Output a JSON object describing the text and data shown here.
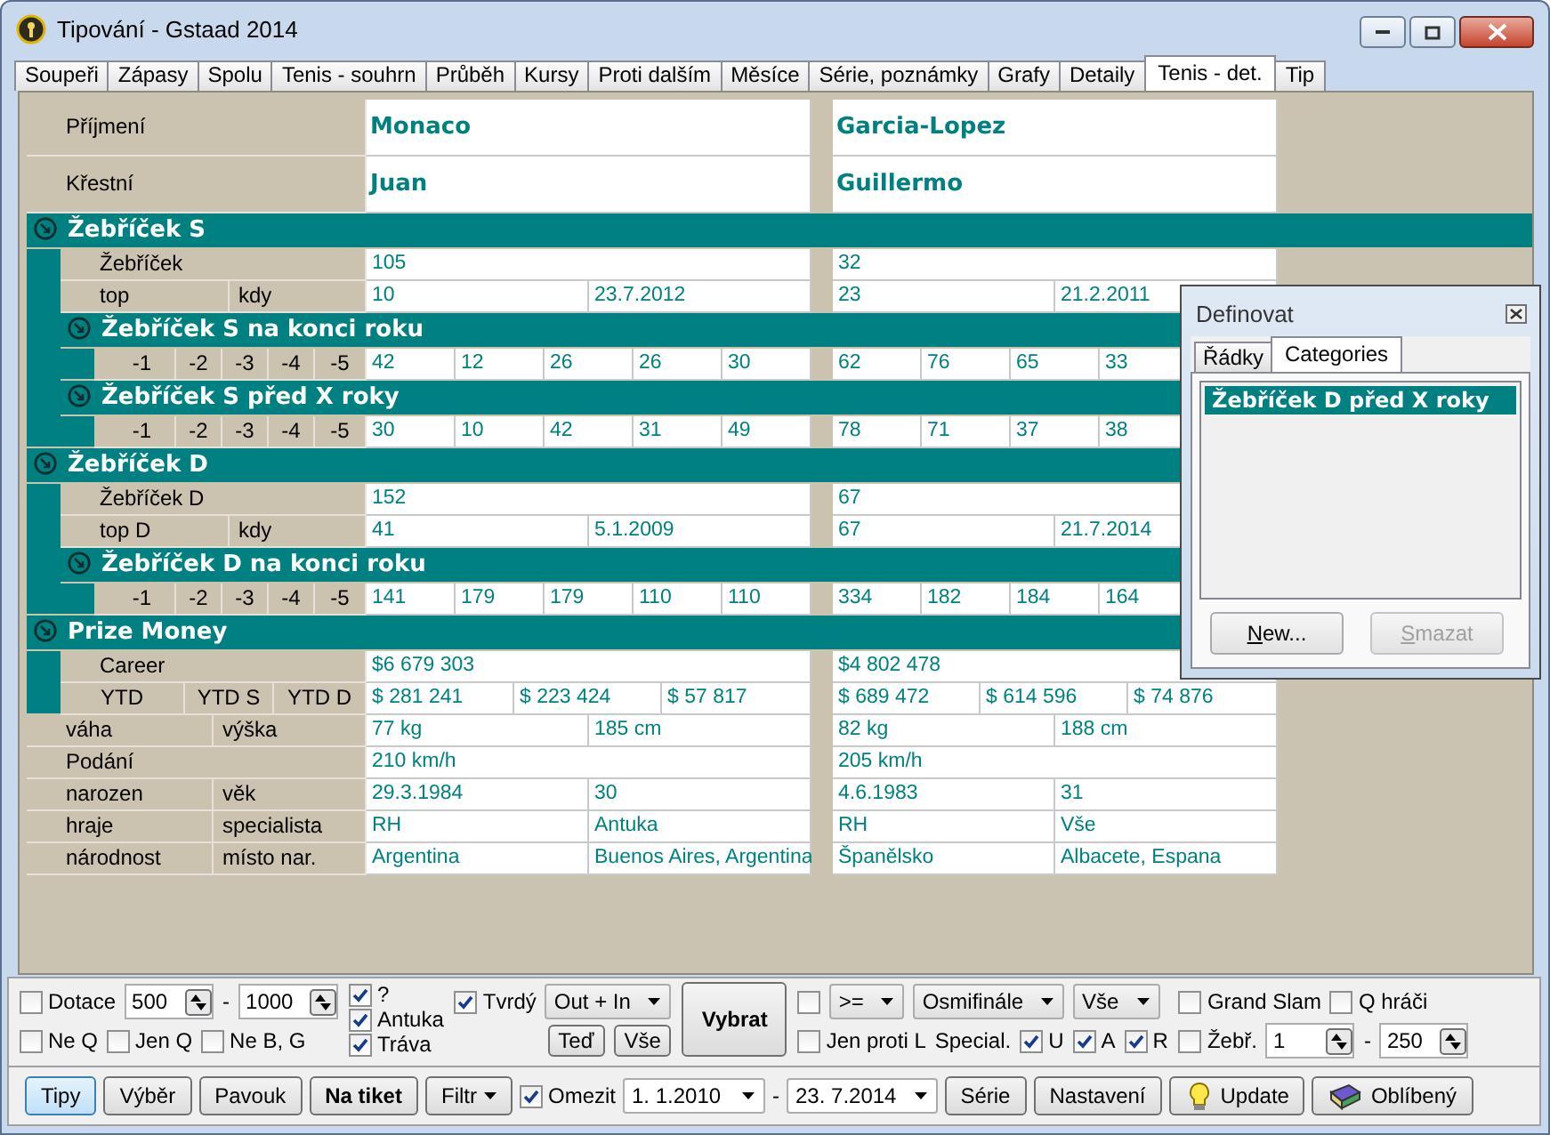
{
  "window": {
    "title": "Tipování - Gstaad 2014"
  },
  "tabs": [
    {
      "label": "Soupeři",
      "selected": false
    },
    {
      "label": "Zápasy",
      "selected": false
    },
    {
      "label": "Spolu",
      "selected": false
    },
    {
      "label": "Tenis - souhrn",
      "selected": false
    },
    {
      "label": "Průběh",
      "selected": false
    },
    {
      "label": "Kursy",
      "selected": false
    },
    {
      "label": "Proti dalším",
      "selected": false
    },
    {
      "label": "Měsíce",
      "selected": false
    },
    {
      "label": "Série, poznámky",
      "selected": false
    },
    {
      "label": "Grafy",
      "selected": false
    },
    {
      "label": "Detaily",
      "selected": false
    },
    {
      "label": "Tenis - det.",
      "selected": true
    },
    {
      "label": "Tip",
      "selected": false
    }
  ],
  "details": [
    {
      "kind": "name",
      "labels": [
        "Příjmení"
      ],
      "cells": [
        [
          "Monaco"
        ],
        [
          "Garcia-Lopez"
        ]
      ]
    },
    {
      "kind": "name",
      "labels": [
        "Křestní"
      ],
      "cells": [
        [
          "Juan"
        ],
        [
          "Guillermo"
        ]
      ]
    },
    {
      "kind": "group",
      "title": "Žebříček S",
      "items": [
        {
          "kind": "row",
          "labels": [
            "Žebříček"
          ],
          "cells": [
            [
              "105"
            ],
            [
              "32"
            ]
          ]
        },
        {
          "kind": "row",
          "labels": [
            "top",
            "kdy"
          ],
          "cells": [
            [
              "10",
              "23.7.2012"
            ],
            [
              "23",
              "21.2.2011"
            ]
          ]
        },
        {
          "kind": "group",
          "title": "Žebříček S na konci roku",
          "items": [
            {
              "kind": "row",
              "labels": [
                "-1",
                "-2",
                "-3",
                "-4",
                "-5"
              ],
              "cells": [
                [
                  "42",
                  "12",
                  "26",
                  "26",
                  "30"
                ],
                [
                  "62",
                  "76",
                  "65",
                  "33"
                ]
              ]
            }
          ]
        },
        {
          "kind": "group",
          "title": "Žebříček S před X roky",
          "items": [
            {
              "kind": "row",
              "labels": [
                "-1",
                "-2",
                "-3",
                "-4",
                "-5"
              ],
              "cells": [
                [
                  "30",
                  "10",
                  "42",
                  "31",
                  "49"
                ],
                [
                  "78",
                  "71",
                  "37",
                  "38"
                ]
              ]
            }
          ]
        }
      ]
    },
    {
      "kind": "group",
      "title": "Žebříček D",
      "items": [
        {
          "kind": "row",
          "labels": [
            "Žebříček D"
          ],
          "cells": [
            [
              "152"
            ],
            [
              "67"
            ]
          ]
        },
        {
          "kind": "row",
          "labels": [
            "top D",
            "kdy"
          ],
          "cells": [
            [
              "41",
              "5.1.2009"
            ],
            [
              "67",
              "21.7.2014"
            ]
          ]
        },
        {
          "kind": "group",
          "title": "Žebříček D na konci roku",
          "items": [
            {
              "kind": "row",
              "labels": [
                "-1",
                "-2",
                "-3",
                "-4",
                "-5"
              ],
              "cells": [
                [
                  "141",
                  "179",
                  "179",
                  "110",
                  "110"
                ],
                [
                  "334",
                  "182",
                  "184",
                  "164"
                ]
              ]
            }
          ]
        }
      ]
    },
    {
      "kind": "group",
      "title": "Prize Money",
      "items": [
        {
          "kind": "row",
          "labels": [
            "Career"
          ],
          "cells": [
            [
              "$6 679 303"
            ],
            [
              "$4 802 478"
            ]
          ]
        },
        {
          "kind": "row",
          "labels": [
            "YTD",
            "YTD S",
            "YTD D"
          ],
          "cells": [
            [
              "$ 281 241",
              "$ 223 424",
              "$ 57 817"
            ],
            [
              "$ 689 472",
              "$ 614 596",
              "$ 74 876"
            ]
          ]
        }
      ]
    },
    {
      "kind": "row",
      "labels": [
        "váha",
        "výška"
      ],
      "cells": [
        [
          "77 kg",
          "185 cm"
        ],
        [
          "82 kg",
          "188 cm"
        ]
      ]
    },
    {
      "kind": "row",
      "labels": [
        "Podání"
      ],
      "cells": [
        [
          "210 km/h"
        ],
        [
          "205 km/h"
        ]
      ]
    },
    {
      "kind": "row",
      "labels": [
        "narozen",
        "věk"
      ],
      "cells": [
        [
          "29.3.1984",
          "30"
        ],
        [
          "4.6.1983",
          "31"
        ]
      ]
    },
    {
      "kind": "row",
      "labels": [
        "hraje",
        "specialista"
      ],
      "cells": [
        [
          "RH",
          "Antuka"
        ],
        [
          "RH",
          "Vše"
        ]
      ]
    },
    {
      "kind": "row",
      "labels": [
        "národnost",
        "místo nar."
      ],
      "cells": [
        [
          "Argentina",
          "Buenos Aires, Argentina"
        ],
        [
          "Španělsko",
          "Albacete, Espana"
        ]
      ]
    }
  ],
  "popup": {
    "title": "Definovat",
    "tabs": [
      {
        "label": "Řádky",
        "selected": false
      },
      {
        "label": "Categories",
        "selected": true
      }
    ],
    "items": [
      {
        "label": "Žebříček D před X roky",
        "selected": true
      }
    ],
    "buttons": [
      {
        "label": "New...",
        "disabled": false
      },
      {
        "label": "Smazat",
        "disabled": true
      }
    ]
  },
  "filters": {
    "columns": [
      {
        "lines": [
          {
            "items": [
              {
                "kind": "checkbox",
                "label": "Dotace",
                "checked": false
              },
              {
                "kind": "spin",
                "value": "500"
              },
              {
                "kind": "text",
                "text": "-"
              },
              {
                "kind": "spin",
                "value": "1000"
              }
            ]
          },
          {
            "items": [
              {
                "kind": "checkbox",
                "label": "Ne Q",
                "checked": false
              },
              {
                "kind": "checkbox",
                "label": "Jen Q",
                "checked": false
              },
              {
                "kind": "checkbox",
                "label": "Ne B, G",
                "checked": false
              }
            ]
          }
        ]
      },
      {
        "lines": [
          {
            "items": [
              {
                "kind": "checkbox",
                "label": "?",
                "checked": true
              }
            ]
          },
          {
            "items": [
              {
                "kind": "checkbox",
                "label": "Antuka",
                "checked": true
              }
            ]
          },
          {
            "items": [
              {
                "kind": "checkbox",
                "label": "Tráva",
                "checked": true
              }
            ]
          }
        ]
      },
      {
        "lines": [
          {
            "items": [
              {
                "kind": "checkbox",
                "label": "Tvrdý",
                "checked": true
              },
              {
                "kind": "combo",
                "value": "Out + In"
              }
            ]
          },
          {
            "items": [
              {
                "kind": "button",
                "label": "Teď",
                "bold": false
              },
              {
                "kind": "button",
                "label": "Vše",
                "bold": false
              }
            ]
          }
        ]
      },
      {
        "lines": [
          {
            "items": [
              {
                "kind": "button",
                "label": "Vybrat",
                "bold": true
              }
            ]
          }
        ]
      },
      {
        "lines": [
          {
            "items": [
              {
                "kind": "checkbox",
                "checked": false
              },
              {
                "kind": "combo",
                "value": ">="
              },
              {
                "kind": "combo",
                "value": "Osmifinále"
              },
              {
                "kind": "combo",
                "value": "Vše"
              }
            ]
          },
          {
            "items": [
              {
                "kind": "checkbox",
                "label": "Jen proti L",
                "checked": false
              },
              {
                "kind": "text",
                "text": "Special."
              },
              {
                "kind": "checkbox",
                "label": "U",
                "checked": true
              },
              {
                "kind": "checkbox",
                "label": "A",
                "checked": true
              },
              {
                "kind": "checkbox",
                "label": "R",
                "checked": true
              }
            ]
          }
        ]
      },
      {
        "lines": [
          {
            "items": [
              {
                "kind": "checkbox",
                "label": "Grand Slam",
                "checked": false
              },
              {
                "kind": "checkbox",
                "label": "Q hráči",
                "checked": false
              }
            ]
          },
          {
            "items": [
              {
                "kind": "checkbox",
                "label": "Žebř.",
                "checked": false
              },
              {
                "kind": "spin",
                "value": "1"
              },
              {
                "kind": "text",
                "text": "-"
              },
              {
                "kind": "spin",
                "value": "250"
              }
            ]
          }
        ]
      }
    ]
  },
  "toolbar": [
    {
      "kind": "button",
      "label": "Tipy",
      "selected": true,
      "bold": false
    },
    {
      "kind": "button",
      "label": "Výběr",
      "selected": false,
      "bold": false
    },
    {
      "kind": "button",
      "label": "Pavouk",
      "selected": false,
      "bold": false
    },
    {
      "kind": "button",
      "label": "Na tiket",
      "selected": false,
      "bold": true
    },
    {
      "kind": "menu",
      "label": "Filtr"
    },
    {
      "kind": "checkbox",
      "label": "Omezit",
      "checked": true
    },
    {
      "kind": "date",
      "value": "1. 1.2010"
    },
    {
      "kind": "text",
      "text": "-"
    },
    {
      "kind": "date",
      "value": "23. 7.2014"
    },
    {
      "kind": "button",
      "label": "Série",
      "selected": false,
      "bold": false
    },
    {
      "kind": "button",
      "label": "Nastavení",
      "selected": false,
      "bold": false
    },
    {
      "kind": "bulb",
      "label": "Update"
    },
    {
      "kind": "book",
      "label": "Oblíbený"
    }
  ]
}
